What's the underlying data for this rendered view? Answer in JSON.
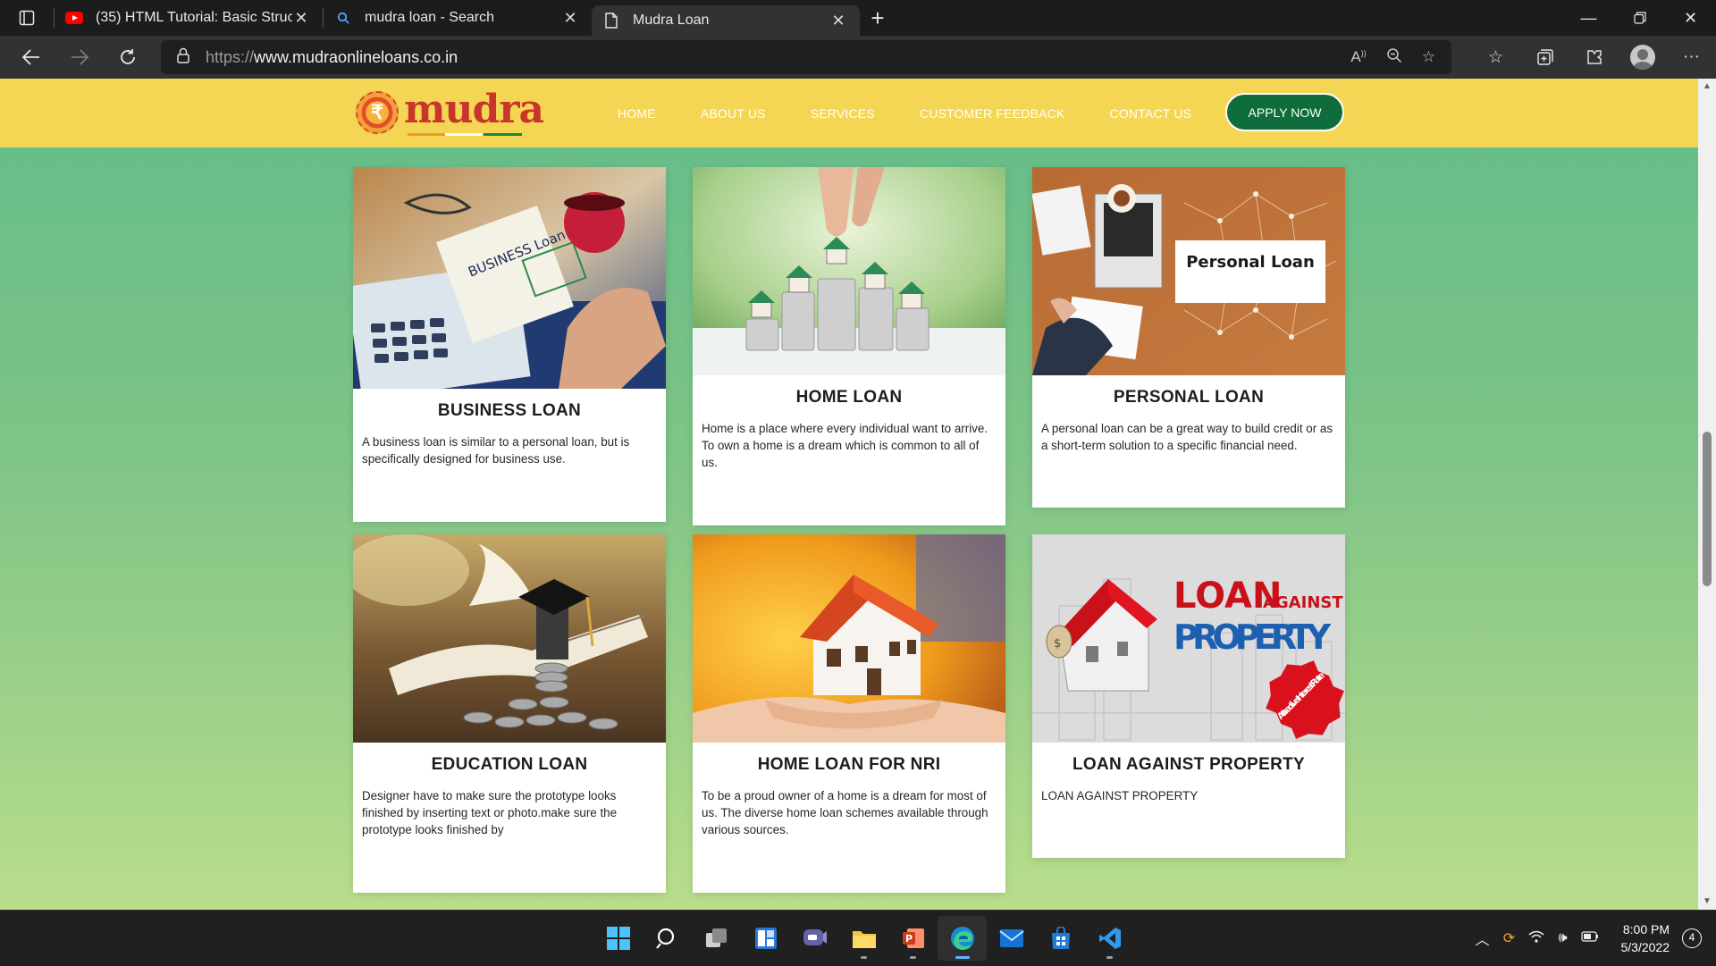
{
  "browser": {
    "tabs": [
      {
        "title": "(35) HTML Tutorial: Basic Structu",
        "icon": "youtube-icon"
      },
      {
        "title": "mudra loan - Search",
        "icon": "search-icon"
      },
      {
        "title": "Mudra Loan",
        "icon": "page-icon",
        "active": true
      }
    ],
    "url_scheme": "https://",
    "url_host": "www.mudraonlineloans.co.in"
  },
  "site": {
    "logo_text": "mudra",
    "logo_symbol": "₹",
    "nav": [
      "HOME",
      "ABOUT US",
      "SERVICES",
      "CUSTOMER FEEDBACK",
      "CONTACT US"
    ],
    "apply_label": "APPLY NOW",
    "colors": {
      "header": "#f5d654",
      "apply_button": "#0e6d3a",
      "background_top": "#63bc89",
      "background_bottom": "#b9de8b"
    }
  },
  "cards": [
    {
      "title": "BUSINESS LOAN",
      "text": "A business loan is similar to a personal loan, but is specifically designed for business use.",
      "image_caption": "BUSINESS Loan"
    },
    {
      "title": "HOME LOAN",
      "text": "Home is a place where every individual want to arrive. To own a home is a dream which is common to all of us."
    },
    {
      "title": "PERSONAL LOAN",
      "text": "A personal loan can be a great way to build credit or as a short-term solution to a specific financial need.",
      "image_caption": "Personal Loan"
    },
    {
      "title": "EDUCATION LOAN",
      "text": "Designer have to make sure the prototype looks finished by inserting text or photo.make sure the prototype looks finished by"
    },
    {
      "title": "HOME LOAN FOR NRI",
      "text": "To be a proud owner of a home is a dream for most of us. The diverse home loan schemes available through various sources."
    },
    {
      "title": "LOAN AGAINST PROPERTY",
      "text": "LOAN AGAINST PROPERTY",
      "image_caption_big": "LOAN",
      "image_caption_small": "AGAINST",
      "image_caption_2": "PROPERTY",
      "image_badge": "Attractive Interest Rate"
    }
  ],
  "taskbar": {
    "clock_time": "8:00 PM",
    "clock_date": "5/3/2022",
    "notifications": "4"
  }
}
